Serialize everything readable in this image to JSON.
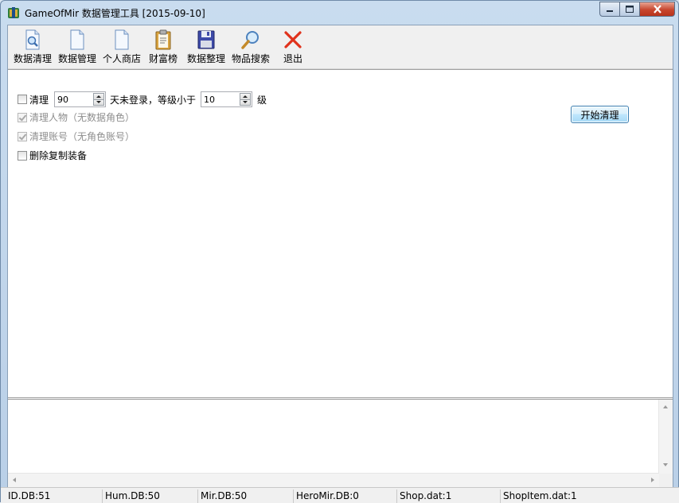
{
  "window": {
    "title": "GameOfMir 数据管理工具 [2015-09-10]"
  },
  "toolbar": {
    "items": [
      {
        "label": "数据清理",
        "icon": "magnifier-document-icon"
      },
      {
        "label": "数据管理",
        "icon": "document-icon"
      },
      {
        "label": "个人商店",
        "icon": "document-icon"
      },
      {
        "label": "财富榜",
        "icon": "clipboard-icon"
      },
      {
        "label": "数据整理",
        "icon": "floppy-disk-icon"
      },
      {
        "label": "物品搜索",
        "icon": "magnifier-icon"
      },
      {
        "label": "退出",
        "icon": "red-x-icon"
      }
    ]
  },
  "cleanup": {
    "clean_label": "清理",
    "days_value": "90",
    "days_suffix": "天未登录，等级小于",
    "level_value": "10",
    "level_suffix": "级",
    "clean_characters_label": "清理人物（无数据角色）",
    "clean_accounts_label": "清理账号（无角色账号）",
    "delete_duplicates_label": "删除复制装备",
    "start_button_label": "开始清理"
  },
  "status": {
    "items": [
      "ID.DB:51",
      "Hum.DB:50",
      "Mir.DB:50",
      "HeroMir.DB:0",
      "Shop.dat:1",
      "ShopItem.dat:1"
    ]
  },
  "colors": {
    "close_button": "#c7462e",
    "accent_blue": "#3c7fb1"
  }
}
